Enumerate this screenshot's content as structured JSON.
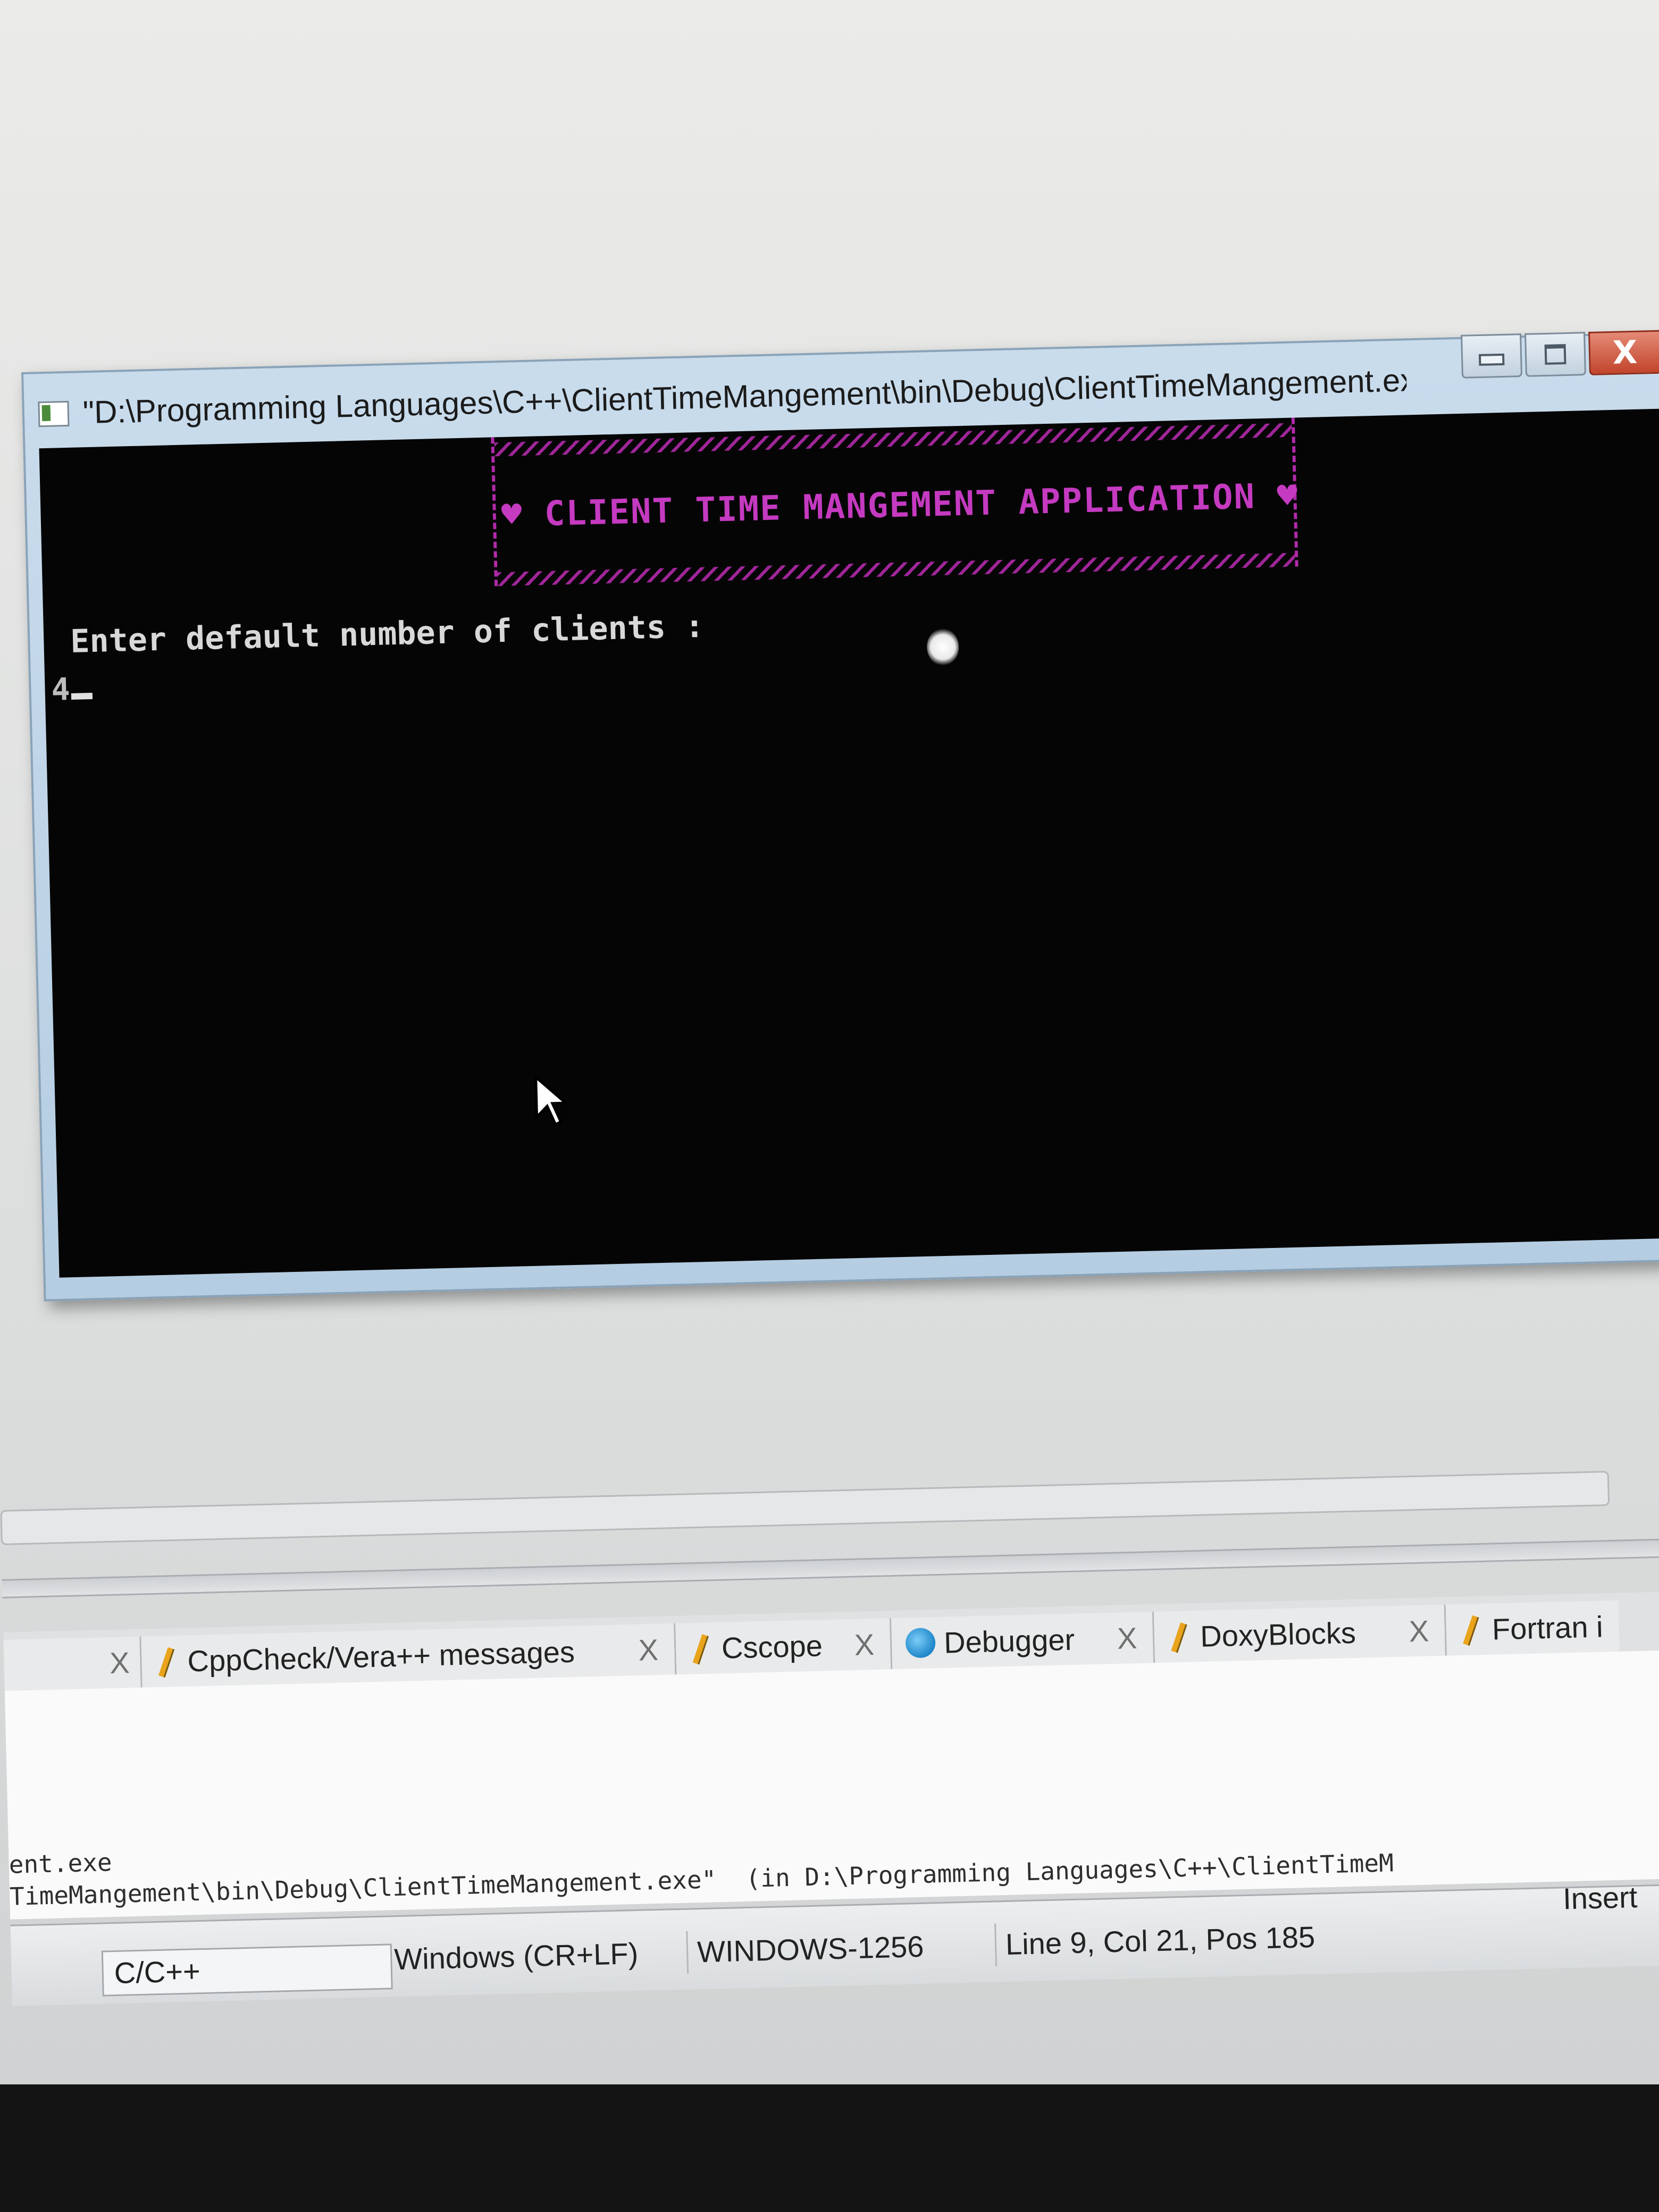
{
  "console_window": {
    "title": "\"D:\\Programming Languages\\C++\\ClientTimeMangement\\bin\\Debug\\ClientTimeMangement.exe\"",
    "controls": {
      "minimize_icon": "minimize-icon",
      "maximize_icon": "maximize-icon",
      "close_icon": "close-icon",
      "close_label": "X"
    },
    "console": {
      "banner_heart": "♥",
      "banner_text": "CLIENT TIME MANGEMENT APPLICATION",
      "banner_color": "#c43ac0",
      "prompt": "Enter default number of clients :",
      "input_value": "4"
    }
  },
  "ide": {
    "tabs": [
      {
        "label": "CppCheck/Vera++ messages",
        "icon": "pencil-icon"
      },
      {
        "label": "Cscope",
        "icon": "pencil-icon"
      },
      {
        "label": "Debugger",
        "icon": "debugger-icon"
      },
      {
        "label": "DoxyBlocks",
        "icon": "pencil-icon"
      },
      {
        "label": "Fortran i",
        "icon": "pencil-icon"
      }
    ],
    "tab_close": "X",
    "log": [
      "ent.exe",
      "TimeMangement\\bin\\Debug\\ClientTimeMangement.exe\"  (in D:\\Programming Languages\\C++\\ClientTimeM"
    ],
    "status": {
      "language": "C/C++",
      "line_endings": "Windows (CR+LF)",
      "encoding": "WINDOWS-1256",
      "position": "Line 9, Col 21, Pos 185",
      "mode": "Insert"
    }
  }
}
